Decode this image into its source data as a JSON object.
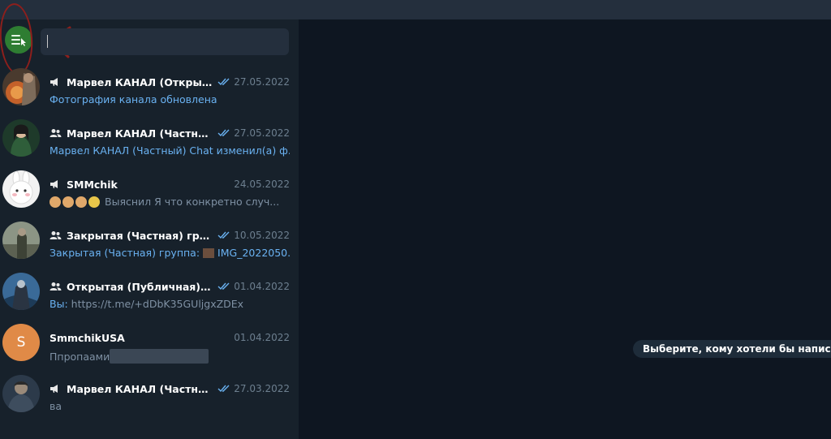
{
  "search": {
    "value": "",
    "placeholder": ""
  },
  "chats": [
    {
      "name": "Марвел КАНАЛ (Открытая)",
      "type": "channel-icon",
      "read": true,
      "date": "27.05.2022",
      "preview": "Фотография канала обновлена"
    },
    {
      "name": "Марвел КАНАЛ (Частный) ...",
      "type": "group-icon",
      "read": true,
      "date": "27.05.2022",
      "preview": "Марвел КАНАЛ (Частный) Chat изменил(а) ф..."
    },
    {
      "name": "SMMchik",
      "type": "channel-icon",
      "read": false,
      "date": "24.05.2022",
      "preview": "Выяснил Я что конкретно случ..."
    },
    {
      "name": "Закрытая (Частная) группа",
      "type": "group-icon",
      "read": true,
      "date": "10.05.2022",
      "preview_sender": "Закрытая (Частная) группа:",
      "preview": "IMG_2022050..."
    },
    {
      "name": "Открытая (Публичная) гр...",
      "type": "group-icon",
      "read": true,
      "date": "01.04.2022",
      "preview_sender": "Вы:",
      "preview": "https://t.me/+dDbK35GUljgxZDEx"
    },
    {
      "name": "SmmchikUSA",
      "type": "none",
      "read": false,
      "date": "01.04.2022",
      "avatar_letter": "S",
      "preview": "Ппропаами"
    },
    {
      "name": "Марвел КАНАЛ (Частный)",
      "type": "channel-icon",
      "read": true,
      "date": "27.03.2022",
      "preview": "ва"
    }
  ],
  "main": {
    "select_hint": "Выберите, кому хотели бы написа"
  },
  "colors": {
    "accent": "#6ab2f2",
    "sidebar_bg": "#17212b",
    "main_bg": "#0e1621",
    "annotation": "#8e1f1c"
  }
}
